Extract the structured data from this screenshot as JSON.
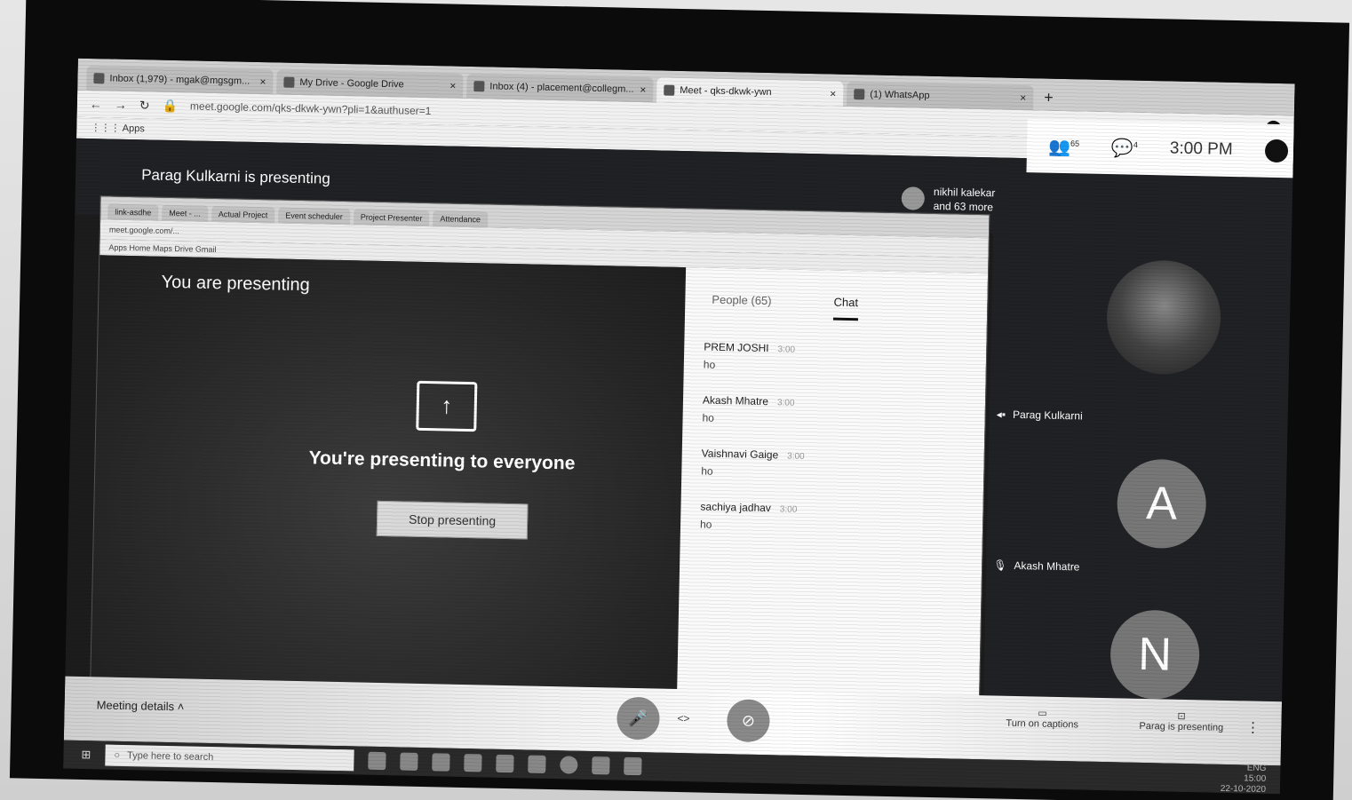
{
  "browser": {
    "tabs": [
      {
        "label": "Inbox (1,979) - mgak@mgsgm..."
      },
      {
        "label": "My Drive - Google Drive"
      },
      {
        "label": "Inbox (4) - placement@collegm..."
      },
      {
        "label": "Meet - qks-dkwk-ywn"
      },
      {
        "label": "(1) WhatsApp"
      }
    ],
    "url": "meet.google.com/qks-dkwk-ywn?pli=1&authuser=1",
    "apps_label": "Apps"
  },
  "meet": {
    "presenter_banner": "Parag Kulkarni is presenting",
    "participants_summary": "nikhil kalekar\nand 63 more",
    "participant_count": "65",
    "chat_badge": "4",
    "time": "3:00 PM"
  },
  "shared_screen": {
    "inner_tabs": [
      "link-asdhe",
      "Meet - ...",
      "Actual Project",
      "Event scheduler",
      "Project Presenter",
      "Attendance"
    ],
    "inner_url": "meet.google.com/...",
    "inner_bookmarks": "Apps  Home  Maps  Drive  Gmail",
    "you_are_presenting": "You are presenting",
    "presenting_message": "You're presenting to everyone",
    "stop_button": "Stop presenting",
    "panel_tabs": {
      "people": "People (65)",
      "chat": "Chat"
    },
    "messages": [
      {
        "author": "PREM JOSHI",
        "time": "3:00",
        "text": "ho"
      },
      {
        "author": "Akash Mhatre",
        "time": "3:00",
        "text": "ho"
      },
      {
        "author": "Vaishnavi Gaige",
        "time": "3:00",
        "text": "ho"
      },
      {
        "author": "sachiya jadhav",
        "time": "3:00",
        "text": "ho"
      }
    ]
  },
  "tiles": [
    {
      "name": "Parag Kulkarni",
      "initial": ""
    },
    {
      "name": "Akash Mhatre",
      "initial": "A"
    },
    {
      "name": "",
      "initial": "N"
    }
  ],
  "controls": {
    "meeting_details": "Meeting details",
    "turn_on_captions": "Turn on captions",
    "present_now": "Parag is presenting",
    "hangup_arrow": "<>"
  },
  "taskbar": {
    "search_placeholder": "Type here to search",
    "time": "15:00",
    "date": "22-10-2020",
    "lang": "ENG"
  }
}
